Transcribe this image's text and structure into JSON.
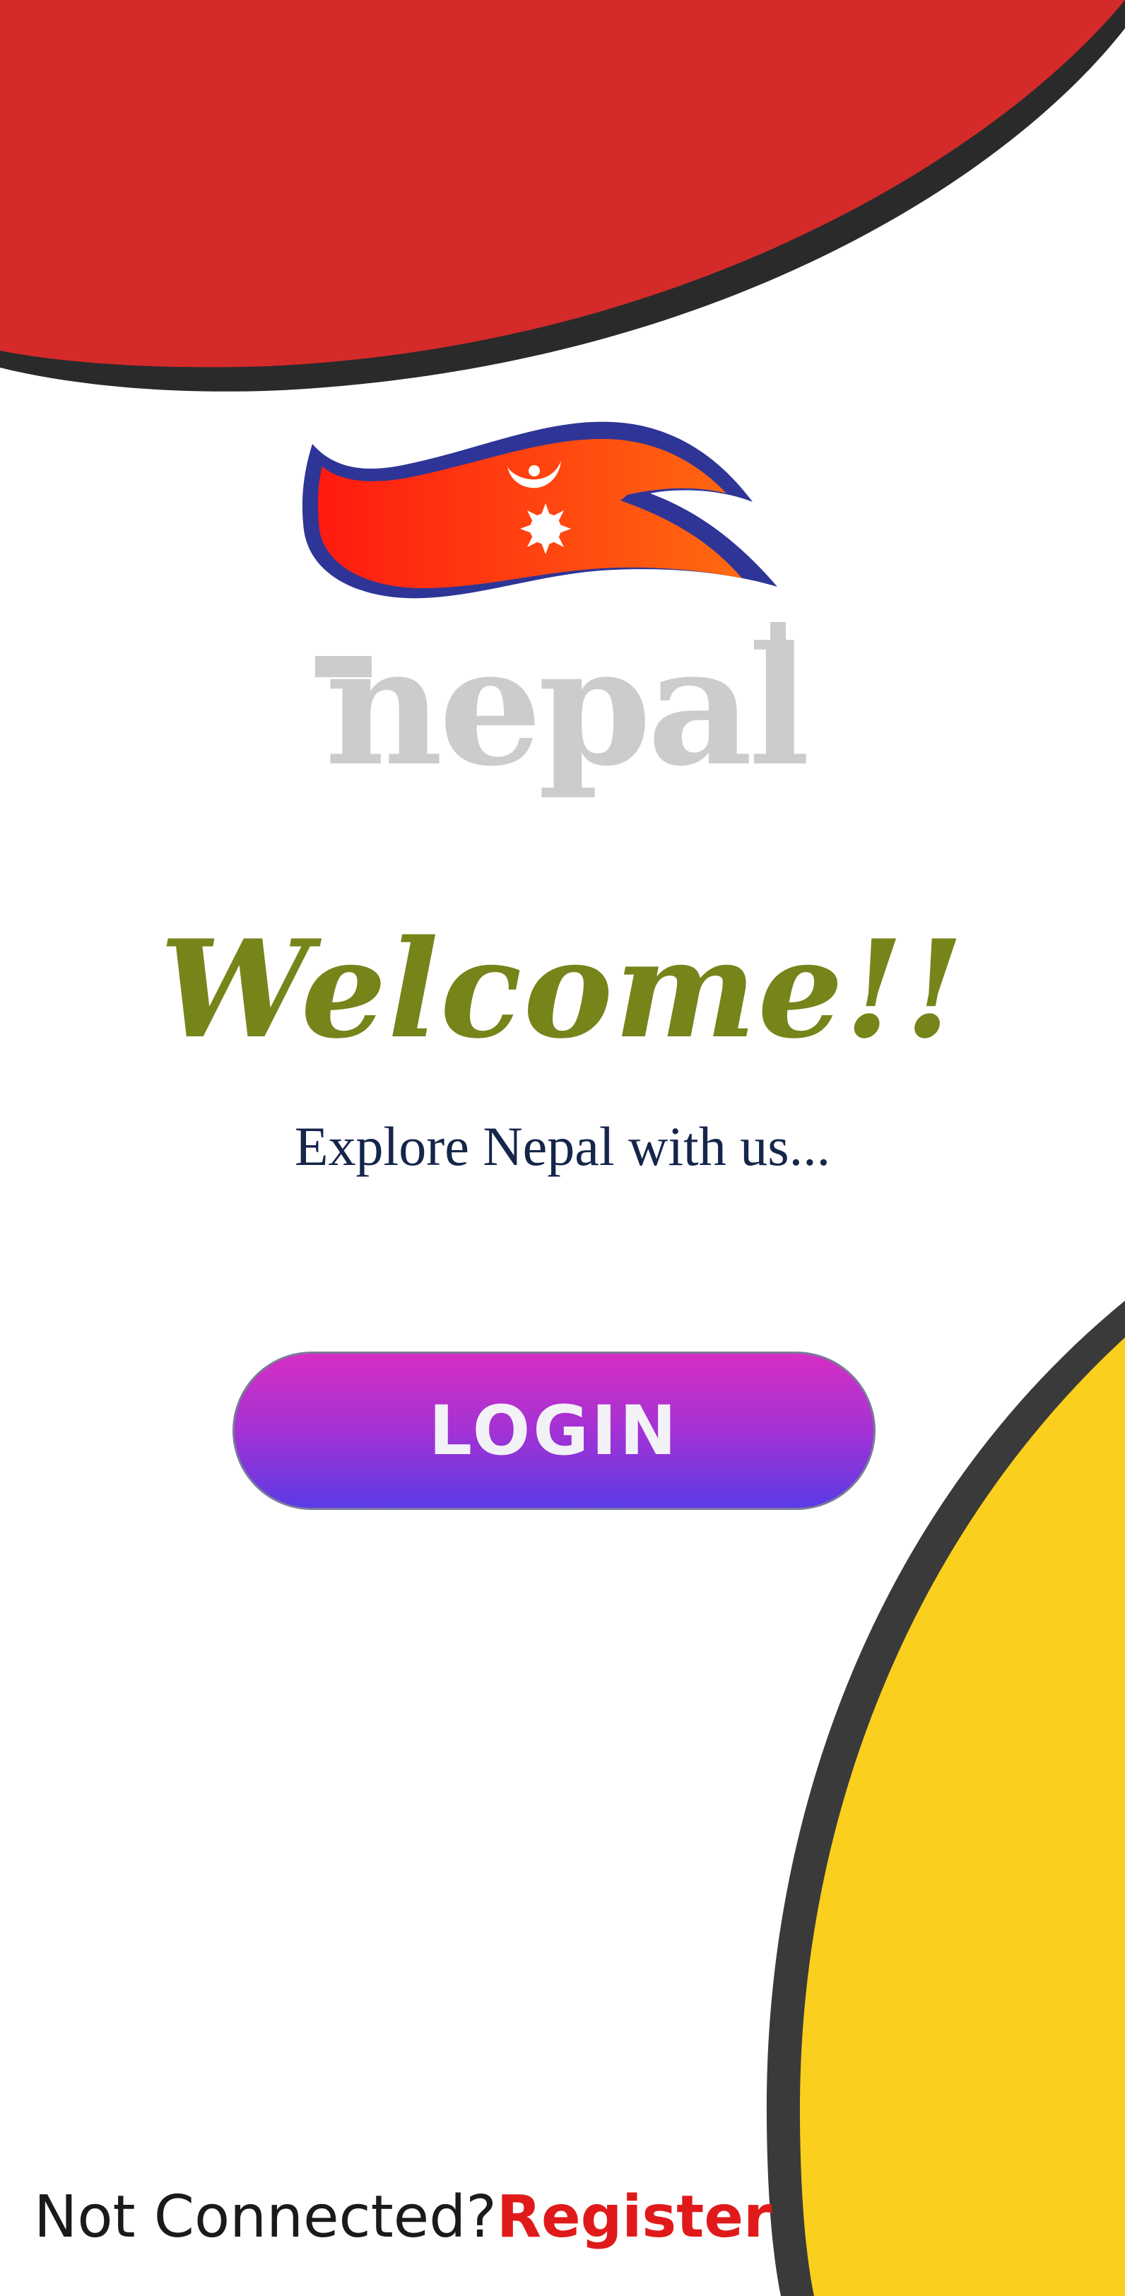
{
  "colors": {
    "top_blob": "#d42a2a",
    "top_blob_shadow": "#2a2a2a",
    "bottom_blob": "#fbcf1e",
    "bottom_blob_border": "#3a3a3a",
    "welcome": "#76841a",
    "tagline": "#15264a",
    "login_gradient_top": "#d62ec4",
    "login_gradient_bottom": "#5b3ae6",
    "register": "#e01a1a"
  },
  "logo": {
    "wordmark": "nepal",
    "flag_icon": "nepal-flag-icon"
  },
  "welcome": {
    "title": "Welcome!!",
    "tagline": "Explore Nepal with us..."
  },
  "login": {
    "label": "LOGIN"
  },
  "footer": {
    "question": "Not Connected?",
    "register_label": "Register"
  }
}
